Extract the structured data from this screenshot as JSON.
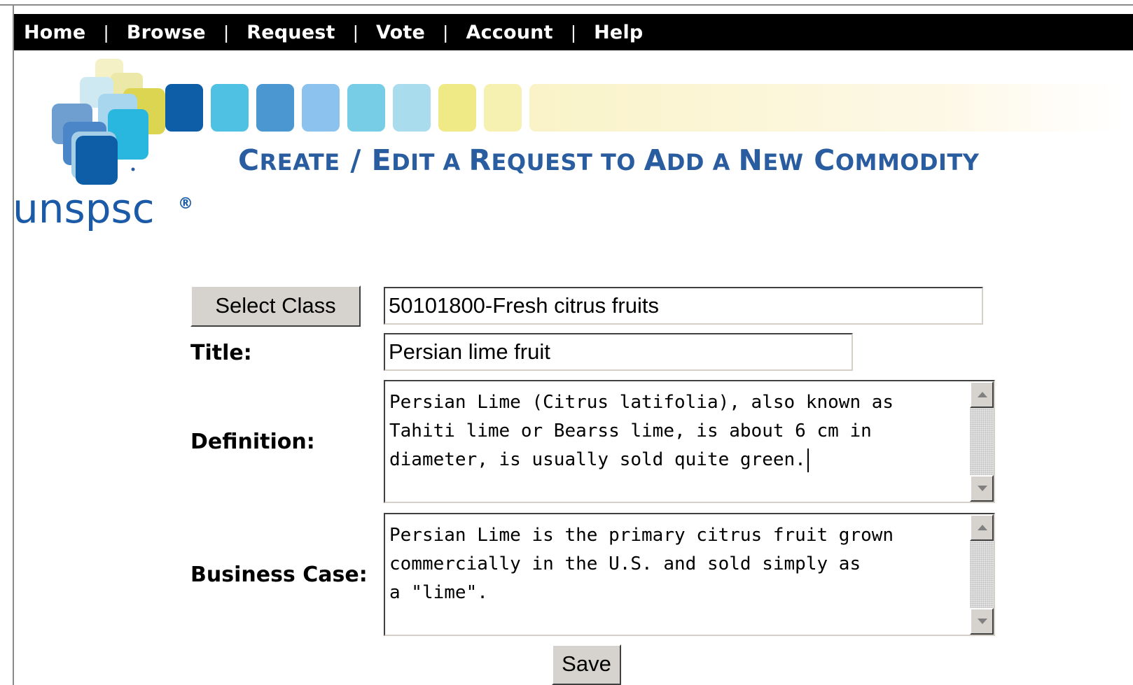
{
  "nav": {
    "items": [
      "Home",
      "Browse",
      "Request",
      "Vote",
      "Account",
      "Help"
    ],
    "separator": "|"
  },
  "logo": {
    "brand": "unspsc",
    "mark": "®"
  },
  "page_title": {
    "w1_cap": "C",
    "w1_rest": "REATE",
    "slash": " / ",
    "w2_cap": "E",
    "w2_rest": "DIT",
    "w3": " A ",
    "w4_cap": "R",
    "w4_rest": "EQUEST",
    "w5": " TO ",
    "w6_cap": "A",
    "w6_rest": "DD",
    "w7": " A ",
    "w8_cap": "N",
    "w8_rest": "EW",
    "w9_cap": " C",
    "w9_rest": "OMMODITY"
  },
  "form": {
    "select_class_label": "Select Class",
    "class_value": "50101800-Fresh citrus fruits",
    "title_label": "Title:",
    "title_value": "Persian lime fruit",
    "definition_label": "Definition:",
    "definition_value": "Persian Lime (Citrus latifolia), also known as\nTahiti lime or Bearss lime, is about 6 cm in\ndiameter, is usually sold quite green.",
    "business_case_label": "Business Case:",
    "business_case_value": "Persian Lime is the primary citrus fruit grown\ncommercially in the U.S. and sold simply as\na \"lime\".",
    "save_label": "Save"
  },
  "colors": {
    "nav_bg": "#000000",
    "title_blue": "#2a5da0",
    "logo_blue": "#1a5aa6",
    "squares": [
      "#0d5ea7",
      "#4fc2e4",
      "#4a97d2",
      "#8cc2ee",
      "#78cde6",
      "#a9dcec",
      "#f0ea86",
      "#f6f1b0"
    ]
  }
}
